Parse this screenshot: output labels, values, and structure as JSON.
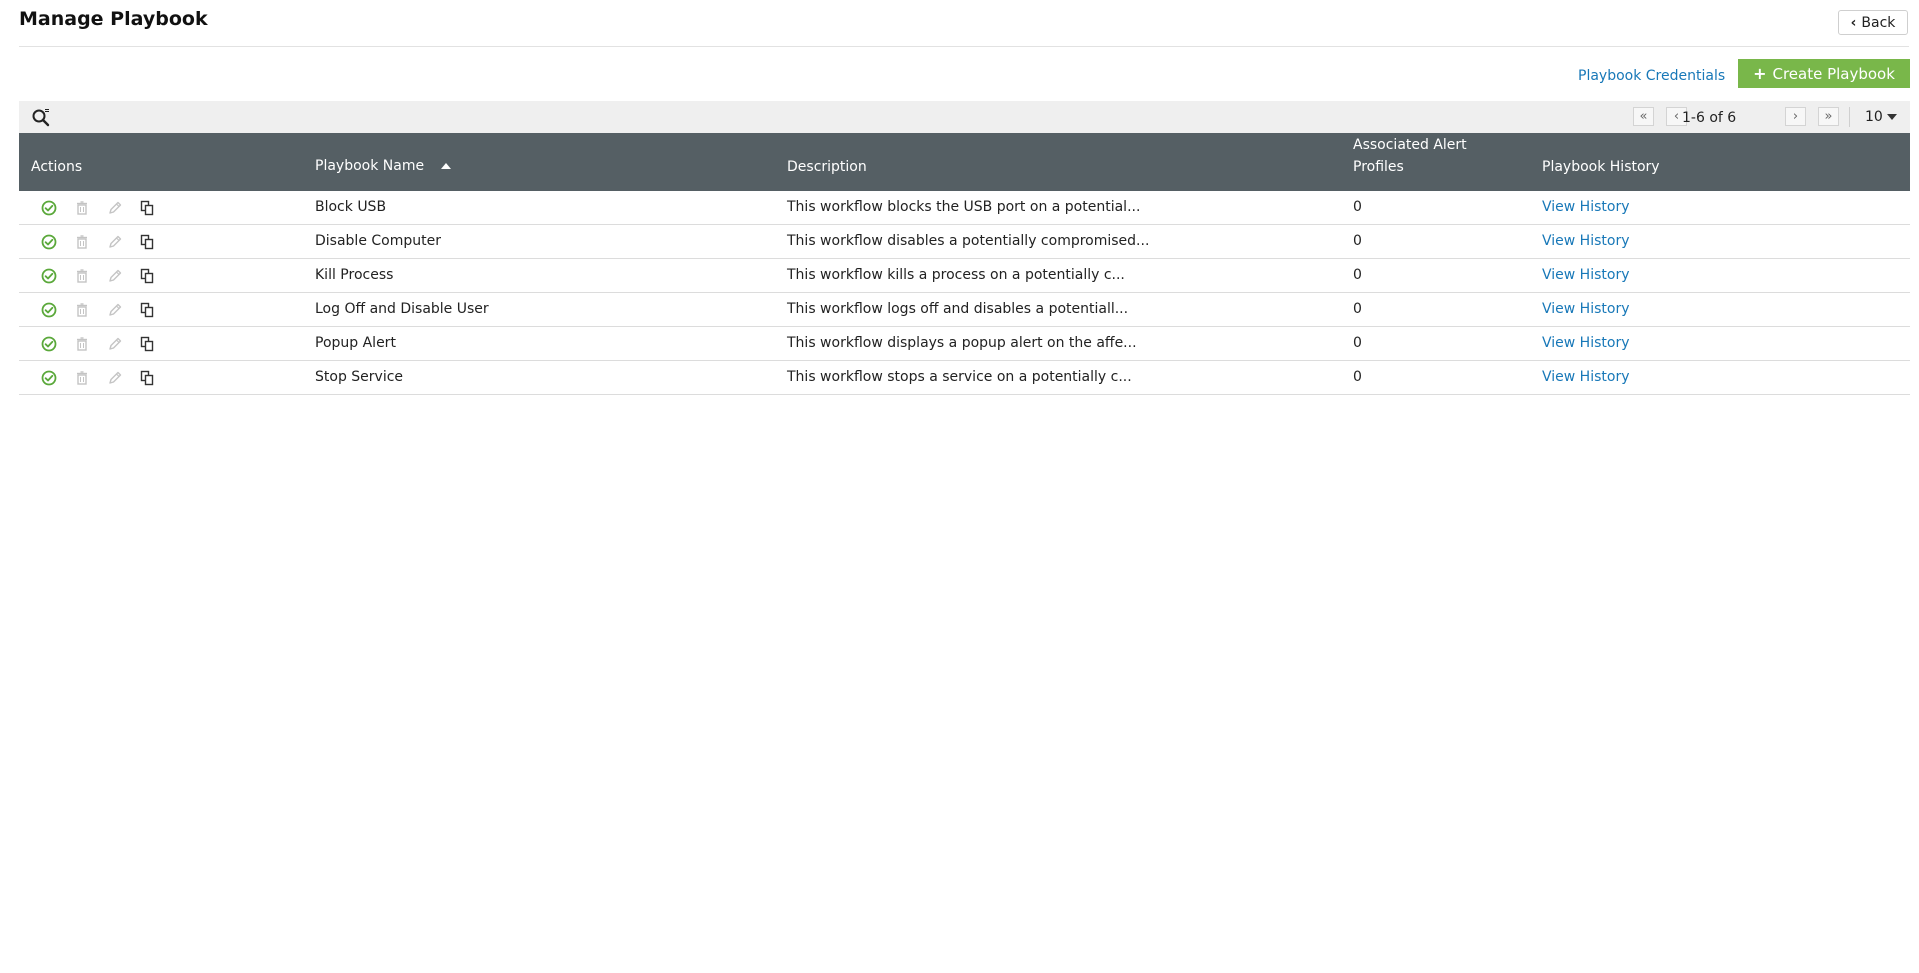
{
  "page": {
    "title": "Manage Playbook"
  },
  "header": {
    "back_label": "Back"
  },
  "actions": {
    "credentials_label": "Playbook Credentials",
    "create_label": "Create Playbook"
  },
  "pager": {
    "range_text": "1-6 of 6",
    "page_size": "10"
  },
  "columns": {
    "actions": "Actions",
    "name": "Playbook Name",
    "description": "Description",
    "alert_profiles_line1": "Associated Alert",
    "alert_profiles_line2": "Profiles",
    "history": "Playbook History"
  },
  "rows": [
    {
      "name": "Block USB",
      "description": "This workflow blocks the USB port on a potential...",
      "alert_profiles": "0",
      "history_link": "View History"
    },
    {
      "name": "Disable Computer",
      "description": "This workflow disables a potentially compromised...",
      "alert_profiles": "0",
      "history_link": "View History"
    },
    {
      "name": "Kill Process",
      "description": "This workflow kills a process on a potentially c...",
      "alert_profiles": "0",
      "history_link": "View History"
    },
    {
      "name": "Log Off and Disable User",
      "description": "This workflow logs off and disables a potentiall...",
      "alert_profiles": "0",
      "history_link": "View History"
    },
    {
      "name": "Popup Alert",
      "description": "This workflow displays a popup alert on the affe...",
      "alert_profiles": "0",
      "history_link": "View History"
    },
    {
      "name": "Stop Service",
      "description": "This workflow stops a service on a potentially c...",
      "alert_profiles": "0",
      "history_link": "View History"
    }
  ],
  "row_action_icons": [
    "enabled-check-icon",
    "delete-icon",
    "edit-icon",
    "copy-icon"
  ],
  "colors": {
    "accent_green": "#79b74a",
    "link_blue": "#1878b8",
    "header_bg": "#555f64",
    "enabled_green": "#5aa83a",
    "disabled_gray": "#c4c4c4"
  },
  "sort": {
    "column": "Playbook Name",
    "direction": "ascending"
  }
}
